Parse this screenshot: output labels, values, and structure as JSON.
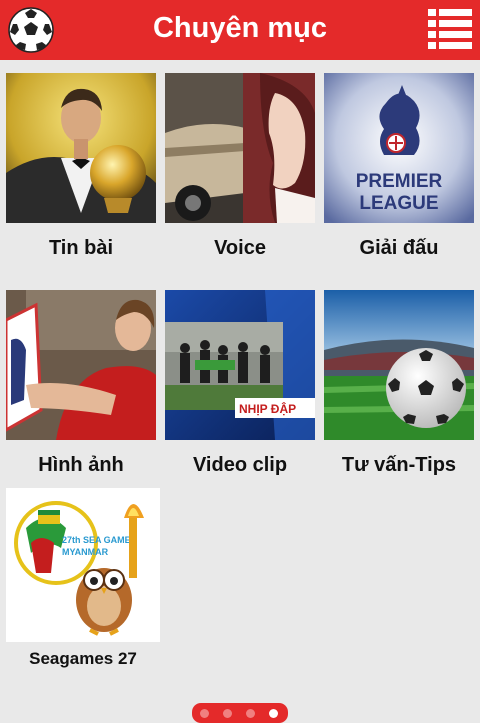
{
  "header": {
    "title": "Chuyên mục",
    "logo_icon": "soccer-ball-icon",
    "menu_icon": "list-menu-icon"
  },
  "categories": [
    {
      "label": "Tin bài",
      "thumb": "player-with-golden-ball"
    },
    {
      "label": "Voice",
      "thumb": "woman-profile-and-car"
    },
    {
      "label": "Giải đấu",
      "thumb": "premier-league-logo",
      "logo_text": [
        "PREMIER",
        "LEAGUE"
      ]
    },
    {
      "label": "Hình ảnh",
      "thumb": "player-in-red-jersey"
    },
    {
      "label": "Video clip",
      "thumb": "tv-clip-team-huddle",
      "overlay_text": "NHỊP ĐẬP"
    },
    {
      "label": "Tư vấn-Tips",
      "thumb": "football-on-stadium-pitch"
    },
    {
      "label": "Seagames 27",
      "thumb": "seagames-mascot-with-torch",
      "logo_text": [
        "27th SEA GAMES",
        "MYANMAR"
      ]
    }
  ],
  "pager": {
    "total": 4,
    "active_index": 3
  },
  "colors": {
    "brand_red": "#e42a2a",
    "background": "#e9e9e9"
  }
}
